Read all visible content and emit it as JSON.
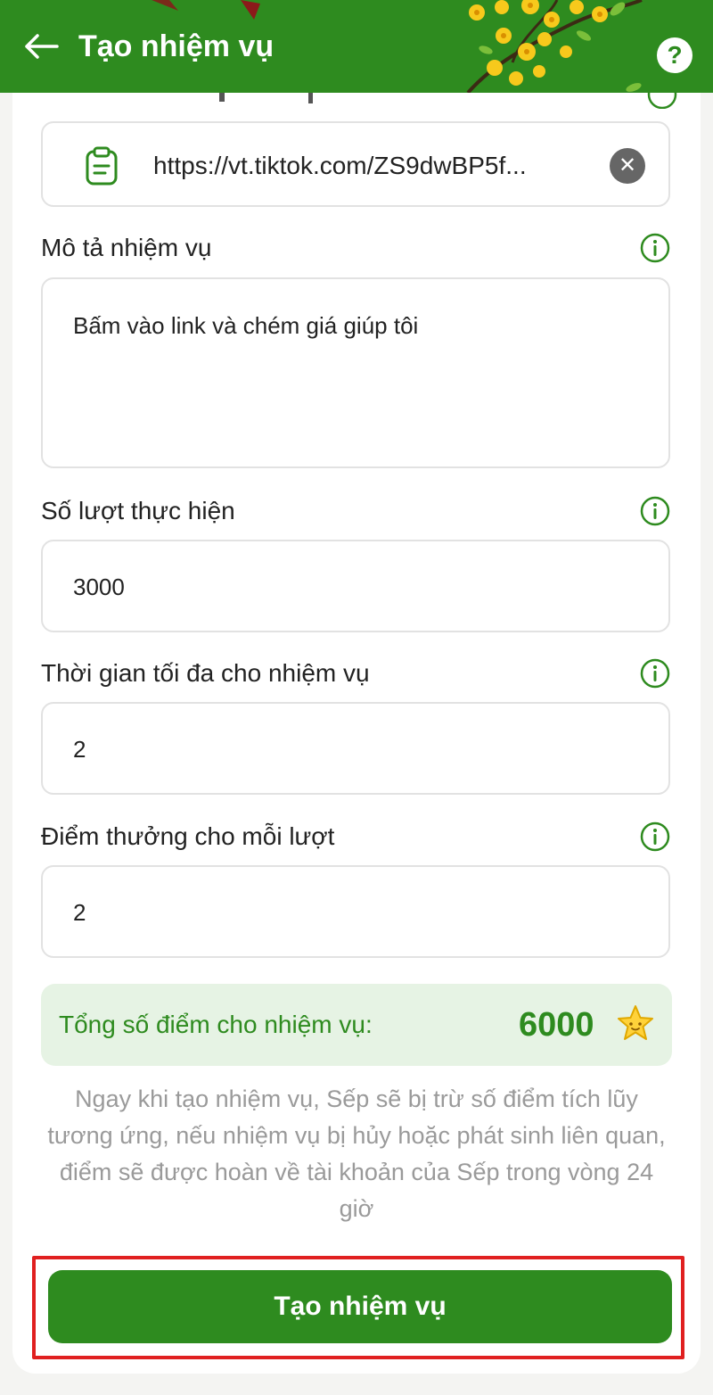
{
  "header": {
    "title": "Tạo nhiệm vụ",
    "back_icon": "arrow-left-icon",
    "help_icon": "help-icon",
    "help_glyph": "?",
    "bg_color": "#2e8b1f"
  },
  "form": {
    "link": {
      "value": "https://vt.tiktok.com/ZS9dwBP5f...",
      "clip_icon": "clipboard-icon",
      "clear_icon": "clear-icon",
      "clear_glyph": "✕"
    },
    "description": {
      "label": "Mô tả nhiệm vụ",
      "value": "Bấm vào link và chém giá giúp tôi"
    },
    "count": {
      "label": "Số lượt thực hiện",
      "value": "3000"
    },
    "max_time": {
      "label": "Thời gian tối đa cho nhiệm vụ",
      "value": "2"
    },
    "reward": {
      "label": "Điểm thưởng cho mỗi lượt",
      "value": "2"
    },
    "info_icon": "info-icon"
  },
  "total": {
    "label": "Tổng số điểm cho nhiệm vụ:",
    "value": "6000",
    "icon": "star-icon"
  },
  "note": "Ngay khi tạo nhiệm vụ, Sếp sẽ bị trừ số điểm tích lũy tương ứng, nếu nhiệm vụ bị hủy hoặc phát sinh liên quan, điểm sẽ được hoàn về tài khoản của Sếp trong vòng 24 giờ",
  "submit_label": "Tạo nhiệm vụ",
  "colors": {
    "accent": "#2e8b1f",
    "total_bg": "#e6f3e4",
    "highlight": "#e02020"
  }
}
